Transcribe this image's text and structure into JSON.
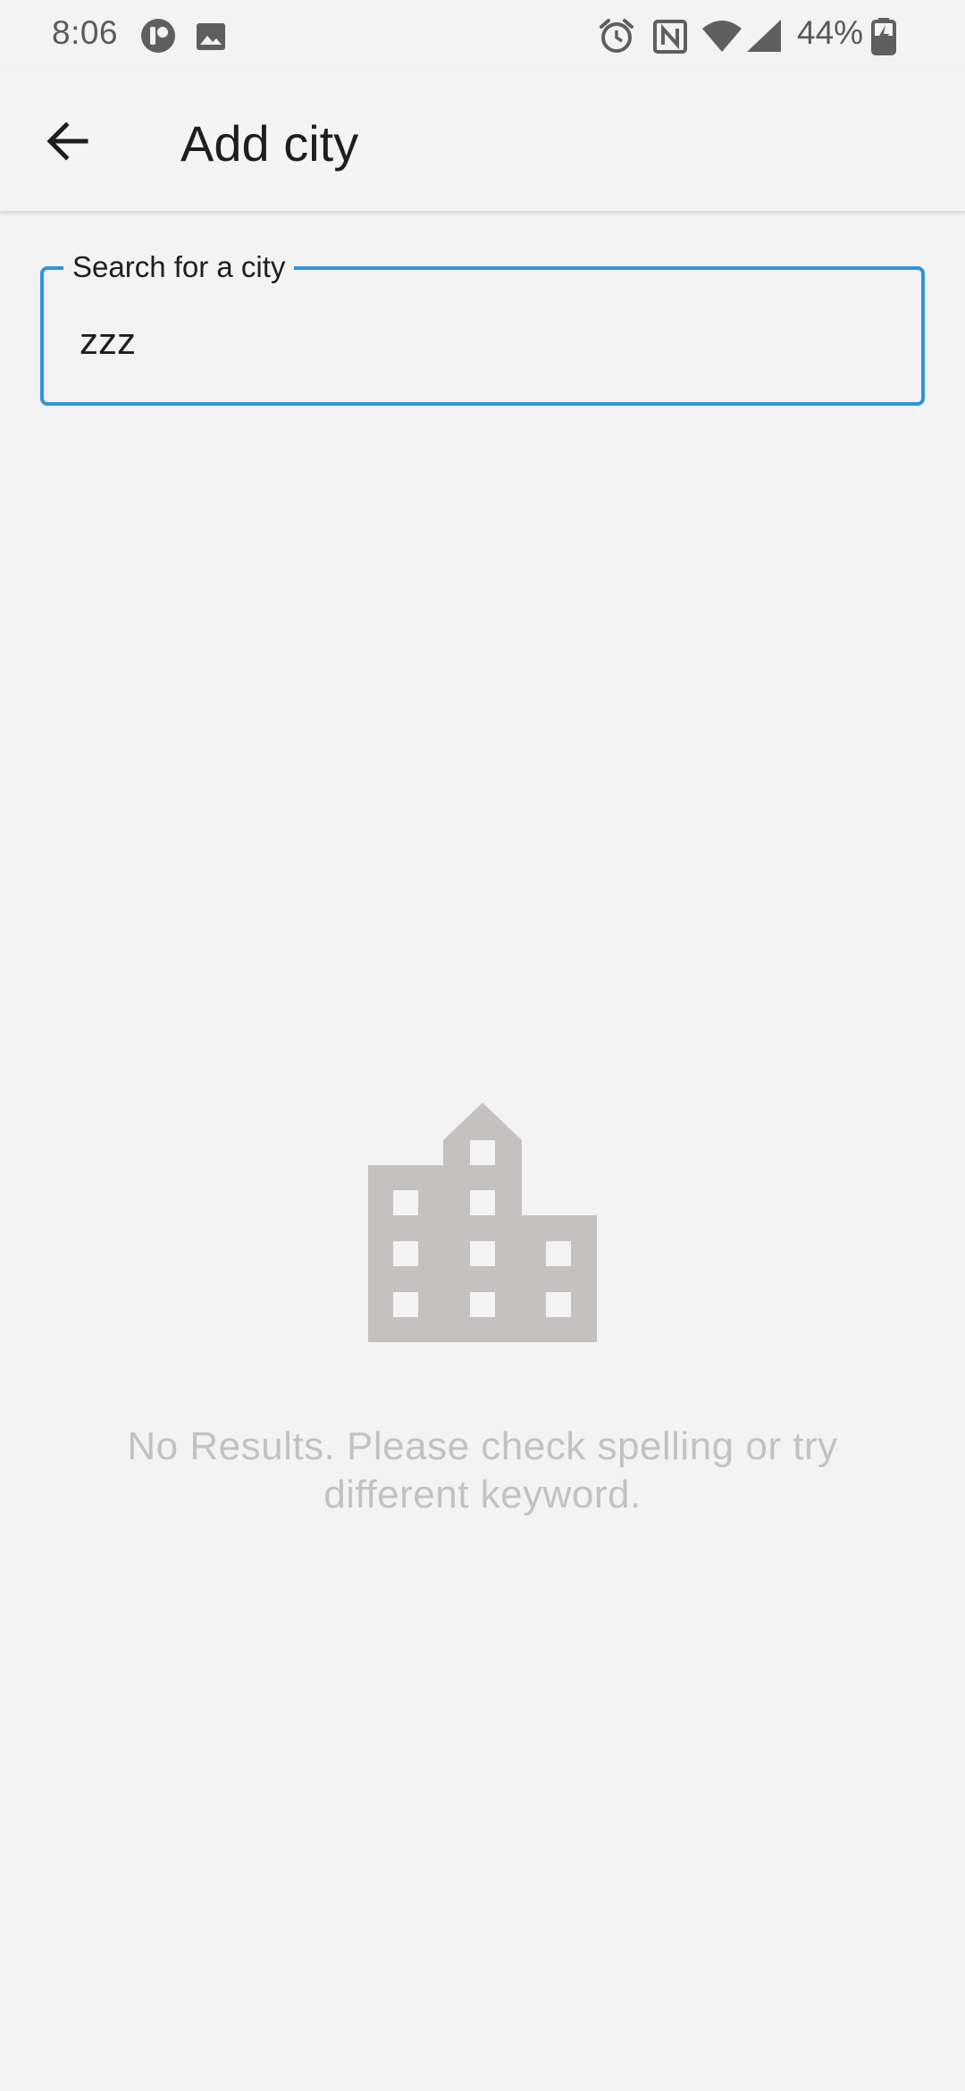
{
  "status_bar": {
    "time": "8:06",
    "battery_percent": "44%",
    "icons": [
      "app-notification-icon",
      "gallery-icon",
      "alarm-icon",
      "nfc-icon",
      "wifi-icon",
      "signal-icon",
      "battery-charging-icon"
    ]
  },
  "app_bar": {
    "back_icon": "arrow-back-icon",
    "title": "Add city"
  },
  "search": {
    "label": "Search for a city",
    "value": "zzz"
  },
  "empty_state": {
    "icon": "building-icon",
    "message": "No Results. Please check spelling or try different keyword."
  },
  "colors": {
    "accent": "#2f93e0",
    "background": "#f3f3f3",
    "illustration": "#c5c1c1",
    "muted_text": "#c2c2c2"
  }
}
